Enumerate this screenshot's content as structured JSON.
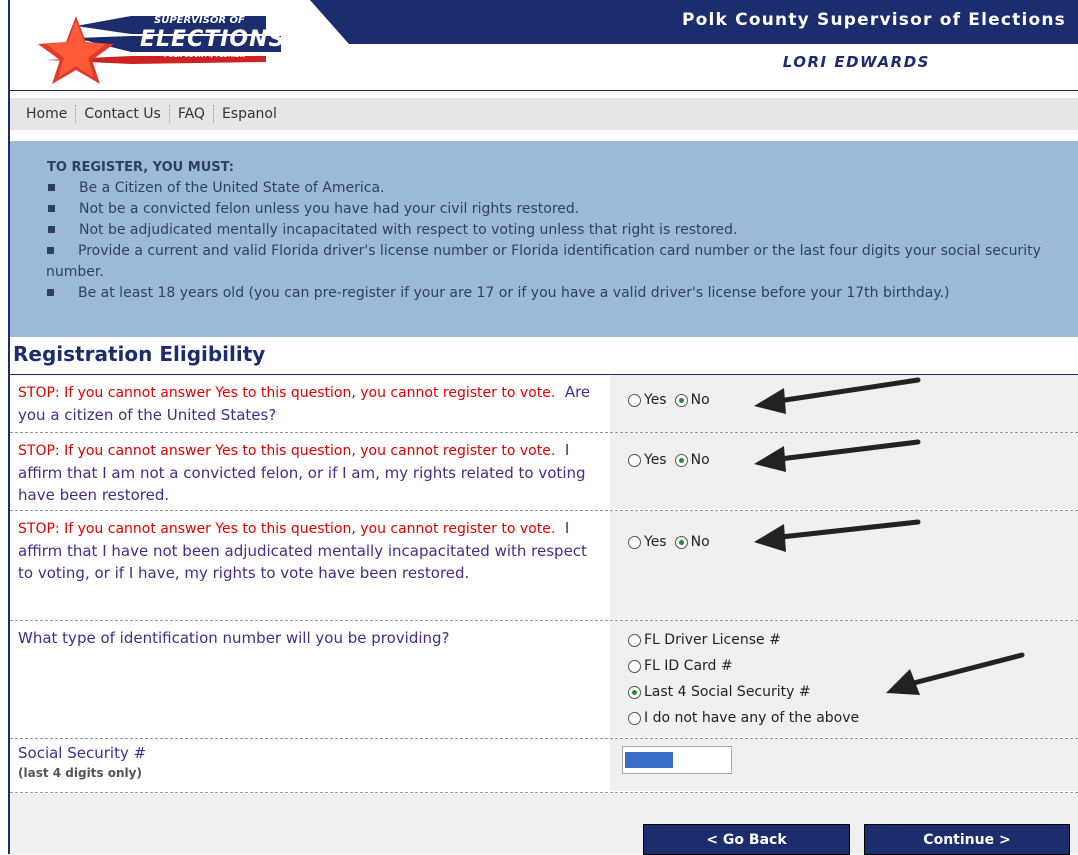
{
  "header": {
    "logo_line1": "SUPERVISOR OF",
    "logo_line2": "ELECTIONS",
    "logo_line3": "POLK COUNTY, FLORIDA",
    "title": "Polk County Supervisor of Elections",
    "name": "LORI EDWARDS"
  },
  "nav": {
    "items": [
      "Home",
      "Contact Us",
      "FAQ",
      "Espanol"
    ]
  },
  "info": {
    "title": "TO REGISTER, YOU MUST:",
    "items": [
      "Be a Citizen of the United State of America.",
      "Not be a convicted felon unless you have had your civil rights restored.",
      "Not be adjudicated mentally incapacitated with respect to voting unless that right is restored.",
      "Provide a current and valid Florida driver's license number or Florida identification card number or the last four digits your social security number.",
      "Be at least 18 years old (you can pre-register if your are 17 or if you have a valid driver's license before your 17th birthday.)"
    ]
  },
  "section_title": "Registration Eligibility",
  "stop_text": "STOP: If you cannot answer Yes to this question, you cannot register to vote.",
  "questions": [
    {
      "text": "Are you a citizen of the United States?",
      "answer": "No"
    },
    {
      "text": "I affirm that I am not a convicted felon, or if I am, my rights related to voting have been restored.",
      "answer": "No"
    },
    {
      "text": "I affirm that I have not been adjudicated mentally incapacitated with respect to voting, or if I have, my rights to vote have been restored.",
      "answer": "No"
    }
  ],
  "yes_label": "Yes",
  "no_label": "No",
  "id_question": {
    "text": "What type of identification number will you be providing?",
    "options": [
      "FL Driver License #",
      "FL ID Card #",
      "Last 4 Social Security #",
      "I do not have any of the above"
    ],
    "selected": "Last 4 Social Security #"
  },
  "ssn": {
    "label": "Social Security #",
    "sublabel": "(last 4 digits only)"
  },
  "buttons": {
    "back": "< Go Back",
    "continue": "Continue >"
  },
  "colors": {
    "navy": "#1c2d6e",
    "info_bg": "#9db9d8",
    "stop_red": "#e00000",
    "question_purple": "#4a2a88"
  }
}
